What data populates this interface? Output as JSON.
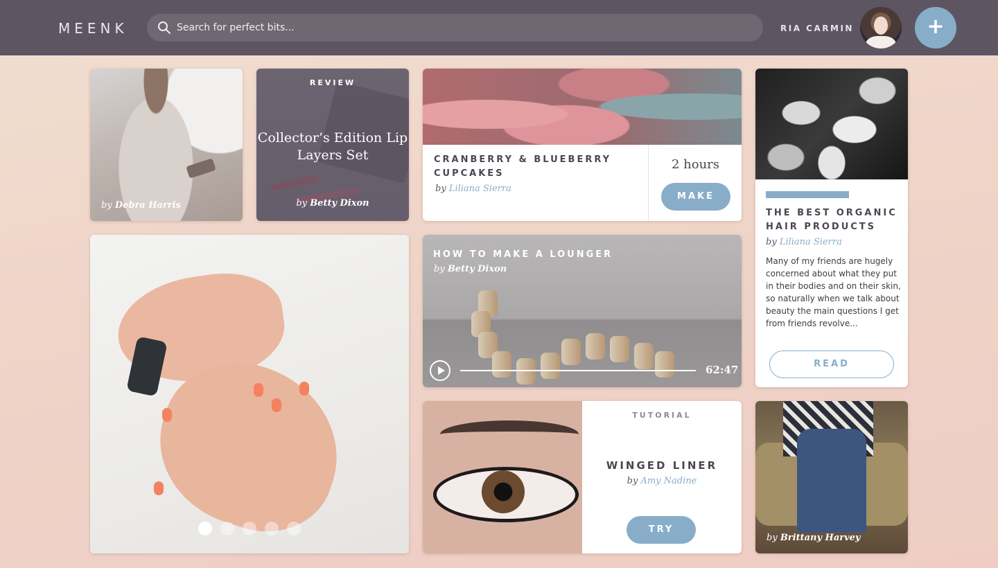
{
  "header": {
    "logo": "MEENK",
    "search_placeholder": "Search for perfect bits...",
    "user_name": "RIA CARMIN",
    "add_label": "+"
  },
  "cards": {
    "photo1": {
      "by": "by",
      "author": "Debra Harris"
    },
    "review": {
      "tag": "REVIEW",
      "title": "Collector’s Edition Lip Layers Set",
      "by": "by",
      "author": "Betty Dixon"
    },
    "recipe": {
      "title": "CRANBERRY & BLUEBERRY CUPCAKES",
      "by": "by",
      "author": "Liliana Sierra",
      "duration": "2 hours",
      "button": "MAKE"
    },
    "article": {
      "title": "THE BEST ORGANIC HAIR PRODUCTS",
      "by": "by",
      "author": "Liliana Sierra",
      "excerpt": "Many of my friends are hugely concerned about what they put in their bodies and on their skin, so naturally when we talk about beauty the main questions I get from friends revolve...",
      "button": "READ"
    },
    "slideshow": {
      "slide_count": 5,
      "active_slide": 1
    },
    "video": {
      "title": "HOW TO MAKE A LOUNGER",
      "by": "by",
      "author": "Betty Dixon",
      "time": "62:47"
    },
    "tutorial": {
      "tag": "TUTORIAL",
      "title": "WINGED LINER",
      "by": "by",
      "author": "Amy Nadine",
      "button": "TRY"
    },
    "photo2": {
      "by": "by",
      "author": "Brittany Harvey"
    }
  },
  "colors": {
    "topbar": "#5d5561",
    "accent": "#87adc9",
    "text_dark": "#4b4650"
  }
}
